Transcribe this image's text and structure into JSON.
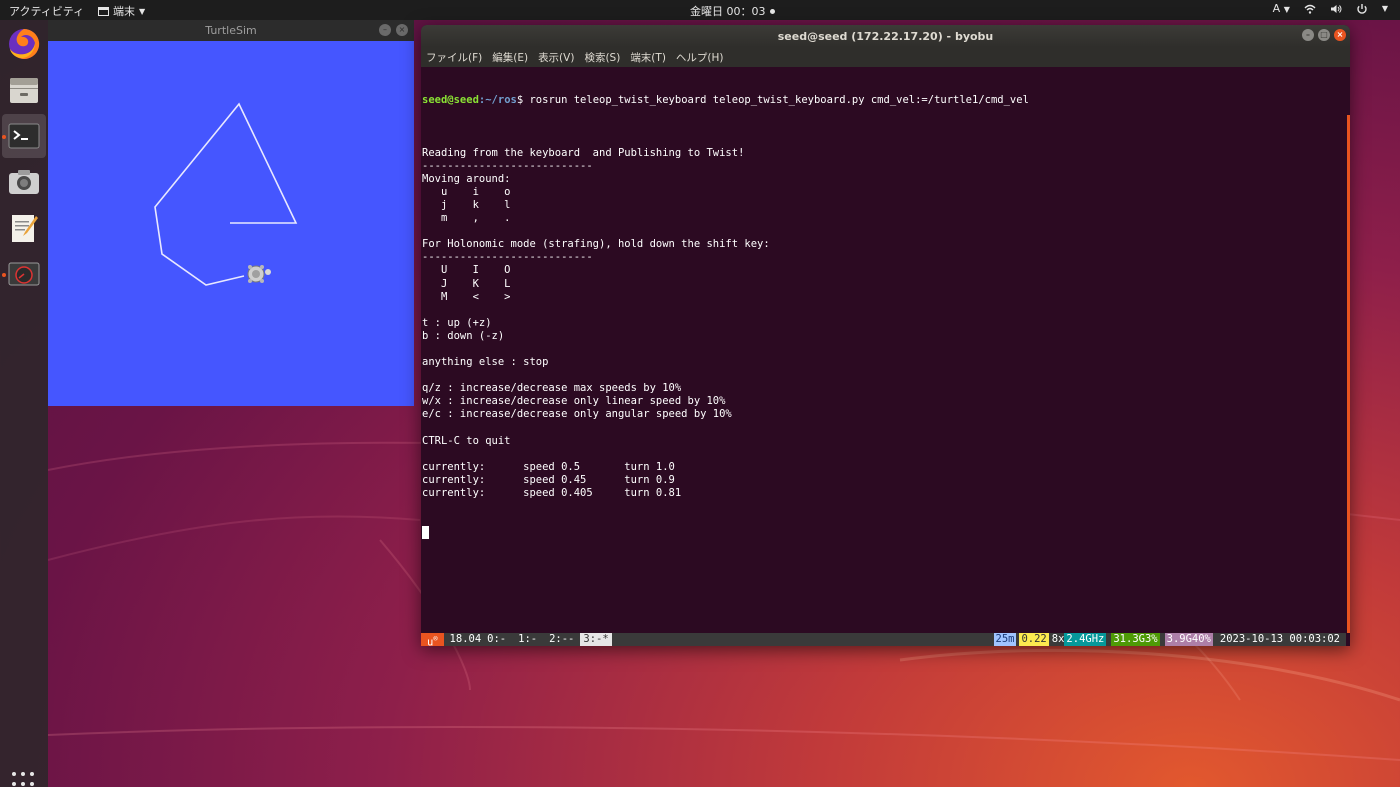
{
  "topbar": {
    "activities": "アクティビティ",
    "app_name": "端末",
    "clock": "金曜日 00：03",
    "input_method": "A"
  },
  "dock": {
    "items": [
      {
        "name": "firefox"
      },
      {
        "name": "files"
      },
      {
        "name": "terminal"
      },
      {
        "name": "screenshot"
      },
      {
        "name": "text-editor"
      },
      {
        "name": "system-monitor"
      }
    ]
  },
  "turtlesim": {
    "title": "TurtleSim",
    "background_color": "#4556ff"
  },
  "terminal": {
    "title": "seed@seed (172.22.17.20) - byobu",
    "menu": [
      "ファイル(F)",
      "編集(E)",
      "表示(V)",
      "検索(S)",
      "端末(T)",
      "ヘルプ(H)"
    ],
    "prompt_user": "seed@seed",
    "prompt_path": ":~/ros",
    "command": "$ rosrun teleop_twist_keyboard teleop_twist_keyboard.py cmd_vel:=/turtle1/cmd_vel",
    "output_lines": [
      "",
      "Reading from the keyboard  and Publishing to Twist!",
      "---------------------------",
      "Moving around:",
      "   u    i    o",
      "   j    k    l",
      "   m    ,    .",
      "",
      "For Holonomic mode (strafing), hold down the shift key:",
      "---------------------------",
      "   U    I    O",
      "   J    K    L",
      "   M    <    >",
      "",
      "t : up (+z)",
      "b : down (-z)",
      "",
      "anything else : stop",
      "",
      "q/z : increase/decrease max speeds by 10%",
      "w/x : increase/decrease only linear speed by 10%",
      "e/c : increase/decrease only angular speed by 10%",
      "",
      "CTRL-C to quit",
      "",
      "currently:      speed 0.5       turn 1.0",
      "currently:      speed 0.45      turn 0.9",
      "currently:      speed 0.405     turn 0.81"
    ]
  },
  "byobu": {
    "logo": "u",
    "release": "18.04",
    "windows": [
      "0:-",
      "1:-",
      "2:--",
      "3:-*"
    ],
    "uptime": "25m",
    "load": "0.22",
    "cpu_count": "8x",
    "cpu_freq": "2.4GHz",
    "mem": "31.3G3%",
    "disk": "3.9G40%",
    "datetime": "2023-10-13 00:03:02"
  },
  "colors": {
    "accent": "#e95420",
    "terminal_bg": "#2c0a22",
    "prompt_green": "#8ae234",
    "prompt_blue": "#729fcf"
  }
}
